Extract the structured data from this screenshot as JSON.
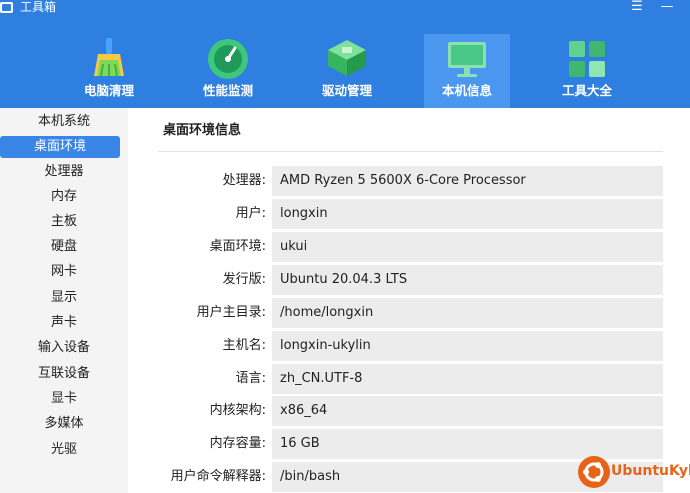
{
  "window": {
    "title": "工具箱",
    "menu_glyph": "☰",
    "minimize_glyph": "—"
  },
  "tabs": [
    {
      "label": "电脑清理",
      "icon": "broom-icon",
      "active": false
    },
    {
      "label": "性能监测",
      "icon": "gauge-icon",
      "active": false
    },
    {
      "label": "驱动管理",
      "icon": "chip-icon",
      "active": false
    },
    {
      "label": "本机信息",
      "icon": "monitor-icon",
      "active": true
    },
    {
      "label": "工具大全",
      "icon": "apps-grid-icon",
      "active": false
    }
  ],
  "sidebar": {
    "items": [
      "本机系统",
      "桌面环境",
      "处理器",
      "内存",
      "主板",
      "硬盘",
      "网卡",
      "显示",
      "声卡",
      "输入设备",
      "互联设备",
      "显卡",
      "多媒体",
      "光驱"
    ],
    "active_index": 1
  },
  "main": {
    "section_title": "桌面环境信息",
    "rows": [
      {
        "key": "处理器:",
        "value": "AMD Ryzen 5 5600X 6-Core Processor"
      },
      {
        "key": "用户:",
        "value": "longxin"
      },
      {
        "key": "桌面环境:",
        "value": "ukui"
      },
      {
        "key": "发行版:",
        "value": "Ubuntu 20.04.3 LTS"
      },
      {
        "key": "用户主目录:",
        "value": "/home/longxin"
      },
      {
        "key": "主机名:",
        "value": "longxin-ukylin"
      },
      {
        "key": "语言:",
        "value": "zh_CN.UTF-8"
      },
      {
        "key": "内核架构:",
        "value": "x86_64"
      },
      {
        "key": "内存容量:",
        "value": "16 GB"
      },
      {
        "key": "用户命令解释器:",
        "value": "/bin/bash"
      }
    ]
  },
  "brand": {
    "text": "UbuntuKylin"
  },
  "colors": {
    "header": "#2f7fe0",
    "active_tab": "#4a97f0",
    "sidebar_active": "#3a86e6",
    "brand": "#e8631a"
  }
}
